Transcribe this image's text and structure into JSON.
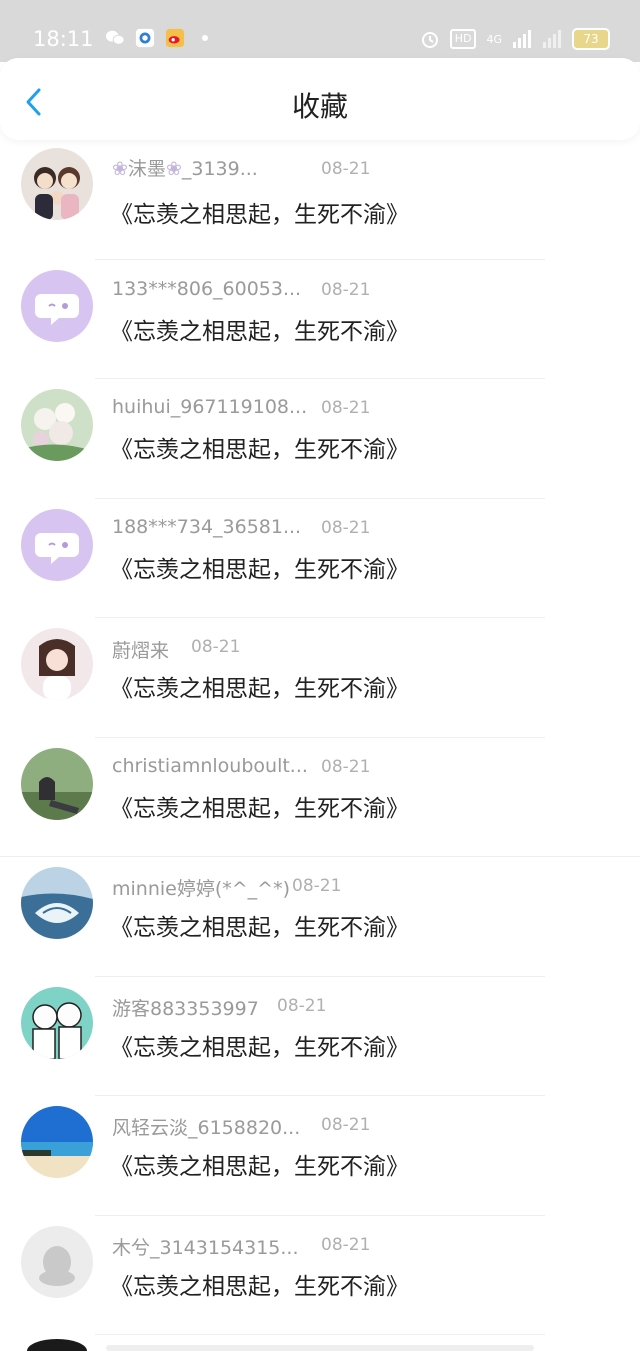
{
  "status_bar": {
    "time": "18:11",
    "hd_label": "HD",
    "network_label": "4G",
    "battery": "73"
  },
  "header": {
    "title": "收藏"
  },
  "items": [
    {
      "username": "沫墨",
      "username_suffix": "_3139...",
      "date": "08-21",
      "title": "《忘羡之相思起，生死不渝》"
    },
    {
      "username": "133***806_60053...",
      "date": "08-21",
      "title": "《忘羡之相思起，生死不渝》"
    },
    {
      "username": "huihui_967119108...",
      "date": "08-21",
      "title": "《忘羡之相思起，生死不渝》"
    },
    {
      "username": "188***734_36581...",
      "date": "08-21",
      "title": "《忘羡之相思起，生死不渝》"
    },
    {
      "username": "蔚熠来",
      "date": "08-21",
      "title": "《忘羡之相思起，生死不渝》"
    },
    {
      "username": "christiamnlouboult...",
      "date": "08-21",
      "title": "《忘羡之相思起，生死不渝》"
    },
    {
      "username": "minnie婷婷(*^_^*)",
      "date": "08-21",
      "title": "《忘羡之相思起，生死不渝》"
    },
    {
      "username": "游客883353997",
      "date": "08-21",
      "title": "《忘羡之相思起，生死不渝》"
    },
    {
      "username": "风轻云淡_6158820...",
      "date": "08-21",
      "title": "《忘羡之相思起，生死不渝》"
    },
    {
      "username": "木兮_3143154315...",
      "date": "08-21",
      "title": "《忘羡之相思起，生死不渝》"
    }
  ]
}
